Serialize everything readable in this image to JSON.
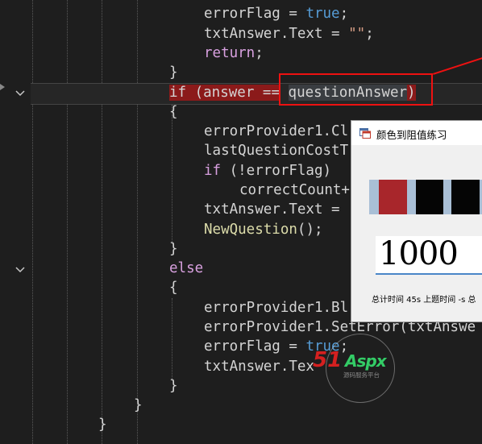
{
  "editor": {
    "lines": [
      {
        "tokens": [
          {
            "t": "errorFlag = ",
            "c": ""
          },
          {
            "t": "true",
            "c": "kw-blue"
          },
          {
            "t": ";",
            "c": ""
          }
        ]
      },
      {
        "tokens": [
          {
            "t": "txtAnswer.Text = ",
            "c": ""
          },
          {
            "t": "\"\"",
            "c": "str"
          },
          {
            "t": ";",
            "c": ""
          }
        ]
      },
      {
        "tokens": [
          {
            "t": "return",
            "c": "kw-purple"
          },
          {
            "t": ";",
            "c": ""
          }
        ]
      },
      {
        "tokens": [
          {
            "t": "}",
            "c": ""
          }
        ]
      },
      {
        "tokens": [
          {
            "t": "if",
            "c": "if-hl"
          },
          {
            "t": " (answer ",
            "c": "if-hl"
          },
          {
            "t": "==",
            "c": "if-hl"
          },
          {
            "t": " ",
            "c": ""
          },
          {
            "t": "questionAnswer",
            "c": "ref-hl"
          },
          {
            "t": ")",
            "c": "if-hl"
          }
        ]
      },
      {
        "tokens": [
          {
            "t": "{",
            "c": ""
          }
        ]
      },
      {
        "tokens": [
          {
            "t": "errorProvider1.Cl",
            "c": ""
          }
        ]
      },
      {
        "tokens": [
          {
            "t": "lastQuestionCostT",
            "c": ""
          }
        ]
      },
      {
        "tokens": [
          {
            "t": "if",
            "c": "kw-purple"
          },
          {
            "t": " (!errorFlag)",
            "c": ""
          }
        ]
      },
      {
        "tokens": [
          {
            "t": "correctCount+",
            "c": ""
          }
        ]
      },
      {
        "tokens": [
          {
            "t": "txtAnswer.Text = ",
            "c": ""
          }
        ]
      },
      {
        "tokens": [
          {
            "t": "NewQuestion",
            "c": "method"
          },
          {
            "t": "();",
            "c": ""
          }
        ]
      },
      {
        "tokens": [
          {
            "t": "}",
            "c": ""
          }
        ]
      },
      {
        "tokens": [
          {
            "t": "else",
            "c": "kw-purple"
          }
        ]
      },
      {
        "tokens": [
          {
            "t": "{",
            "c": ""
          }
        ]
      },
      {
        "tokens": [
          {
            "t": "errorProvider1.Bl",
            "c": ""
          }
        ]
      },
      {
        "tokens": [
          {
            "t": "errorProvider1.SetError(txtAnswe",
            "c": ""
          }
        ]
      },
      {
        "tokens": [
          {
            "t": "errorFlag = ",
            "c": ""
          },
          {
            "t": "true",
            "c": "kw-blue"
          },
          {
            "t": ";",
            "c": ""
          }
        ]
      },
      {
        "tokens": [
          {
            "t": "txtAnswer.Tex",
            "c": ""
          }
        ]
      },
      {
        "tokens": [
          {
            "t": "}",
            "c": ""
          }
        ]
      },
      {
        "tokens": [
          {
            "t": "}",
            "c": ""
          }
        ]
      },
      {
        "tokens": [
          {
            "t": "}",
            "c": ""
          }
        ]
      }
    ]
  },
  "dialog": {
    "title": "颜色到阻值练习",
    "answer_value": "1000",
    "status": "总计时间 45s  上题时间  -s  总",
    "bands": [
      "#a9bfd6",
      "#a8262b",
      "#a9bfd6",
      "#050505",
      "#a9bfd6",
      "#050505",
      "#a9bfd6"
    ]
  },
  "watermark": {
    "brand_num": "51",
    "brand_word": "Aspx",
    "subtitle": "源码服务平台"
  },
  "colors": {
    "editor_bg": "#1e1e1e",
    "if_highlight": "#8b1a1a",
    "annotation_red": "#ee1111"
  }
}
